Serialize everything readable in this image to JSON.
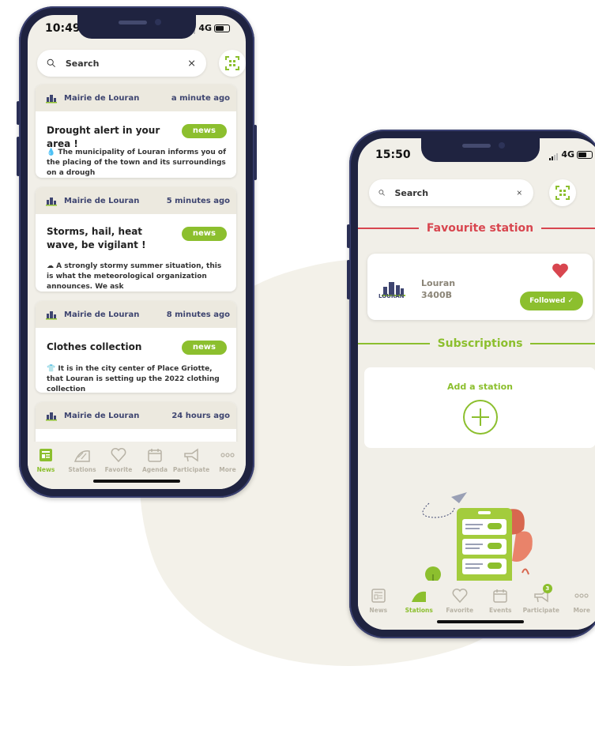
{
  "colors": {
    "accent": "#8cbf2e",
    "red": "#d8464f",
    "navy": "#3e4570",
    "cream": "#f1efe8"
  },
  "phone1": {
    "status": {
      "time": "10:49",
      "network": "4G"
    },
    "search": {
      "placeholder": "Search"
    },
    "feed": [
      {
        "source": "Mairie de Louran",
        "time_ago": "a minute ago",
        "title": "Drought alert in your area !",
        "tag": "news",
        "body": "💧 The municipality of Louran informs you of the placing of the town and its surroundings on a drough"
      },
      {
        "source": "Mairie de Louran",
        "time_ago": "5 minutes ago",
        "title": "Storms, hail, heat wave, be vigilant !",
        "tag": "news",
        "body": "☁ A strongly stormy summer situation, this is what the meteorological organization announces. We ask"
      },
      {
        "source": "Mairie de Louran",
        "time_ago": "8 minutes ago",
        "title": "Clothes collection",
        "tag": "news",
        "body": "👕 It is in the city center of Place Griotte, that Louran is setting up the 2022 clothing collection"
      },
      {
        "source": "Mairie de Louran",
        "time_ago": "24 hours ago"
      }
    ],
    "tabs": [
      {
        "label": "News",
        "icon": "newspaper-icon",
        "active": true
      },
      {
        "label": "Stations",
        "icon": "station-icon"
      },
      {
        "label": "Favorite",
        "icon": "heart-icon"
      },
      {
        "label": "Agenda",
        "icon": "calendar-icon"
      },
      {
        "label": "Participate",
        "icon": "megaphone-icon"
      },
      {
        "label": "More",
        "icon": "more-icon"
      }
    ]
  },
  "phone2": {
    "status": {
      "time": "15:50",
      "network": "4G"
    },
    "search": {
      "placeholder": "Search"
    },
    "favourite_title": "Favourite station",
    "favourite": {
      "logo_text": "LOURAN",
      "name": "Louran",
      "code": "3400B",
      "button": "Followed ✓"
    },
    "subscriptions_title": "Subscriptions",
    "add_station": "Add a station",
    "tabs": [
      {
        "label": "News",
        "icon": "newspaper-icon"
      },
      {
        "label": "Stations",
        "icon": "station-icon",
        "active": true
      },
      {
        "label": "Favorite",
        "icon": "heart-icon"
      },
      {
        "label": "Events",
        "icon": "calendar-icon"
      },
      {
        "label": "Participate",
        "icon": "megaphone-icon",
        "badge": "3"
      },
      {
        "label": "More",
        "icon": "more-icon"
      }
    ]
  }
}
